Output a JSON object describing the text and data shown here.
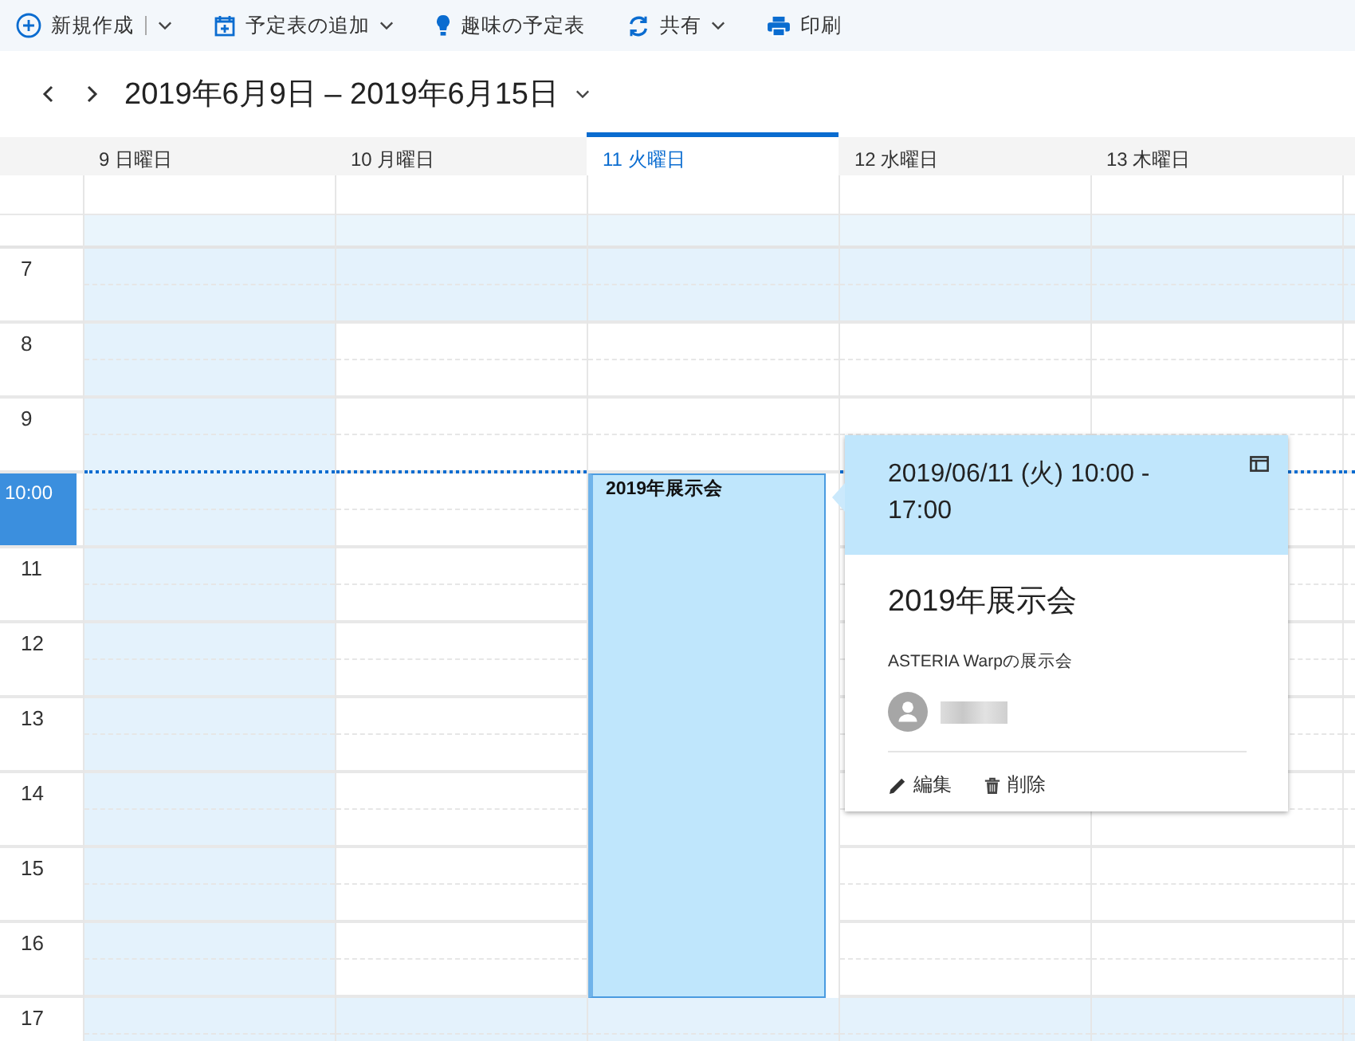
{
  "toolbar": [
    {
      "kind": "new",
      "label": "新規作成",
      "split": true,
      "dropdown": true
    },
    {
      "kind": "add-calendar",
      "label": "予定表の追加",
      "split": false,
      "dropdown": true
    },
    {
      "kind": "interest",
      "label": "趣味の予定表",
      "split": false,
      "dropdown": false
    },
    {
      "kind": "share",
      "label": "共有",
      "split": false,
      "dropdown": true
    },
    {
      "kind": "print",
      "label": "印刷",
      "split": false,
      "dropdown": false
    }
  ],
  "date_range": {
    "title": "2019年6月9日 – 2019年6月15日"
  },
  "days": [
    {
      "label": "9 日曜日",
      "selected": false,
      "non_working": true
    },
    {
      "label": "10 月曜日",
      "selected": false,
      "non_working": false
    },
    {
      "label": "11 火曜日",
      "selected": true,
      "non_working": false,
      "events": [
        {
          "title": "2019年展示会"
        }
      ]
    },
    {
      "label": "12 水曜日",
      "selected": false,
      "non_working": false
    },
    {
      "label": "13 木曜日",
      "selected": false,
      "non_working": false
    }
  ],
  "hours": [
    {
      "label": "7",
      "off_hours": true,
      "current": false
    },
    {
      "label": "8",
      "off_hours": false,
      "current": false
    },
    {
      "label": "9",
      "off_hours": false,
      "current": false
    },
    {
      "label": "10:00",
      "off_hours": false,
      "current": true
    },
    {
      "label": "11",
      "off_hours": false,
      "current": false
    },
    {
      "label": "12",
      "off_hours": false,
      "current": false
    },
    {
      "label": "13",
      "off_hours": false,
      "current": false
    },
    {
      "label": "14",
      "off_hours": false,
      "current": false
    },
    {
      "label": "15",
      "off_hours": false,
      "current": false
    },
    {
      "label": "16",
      "off_hours": false,
      "current": false
    },
    {
      "label": "17",
      "off_hours": true,
      "current": false
    }
  ],
  "event_popup": {
    "date_time": "2019/06/11 (火) 10:00 - 17:00",
    "title": "2019年展示会",
    "description": "ASTERIA Warpの展示会",
    "actions": [
      {
        "kind": "edit",
        "label": "編集"
      },
      {
        "kind": "delete",
        "label": "削除"
      }
    ]
  }
}
